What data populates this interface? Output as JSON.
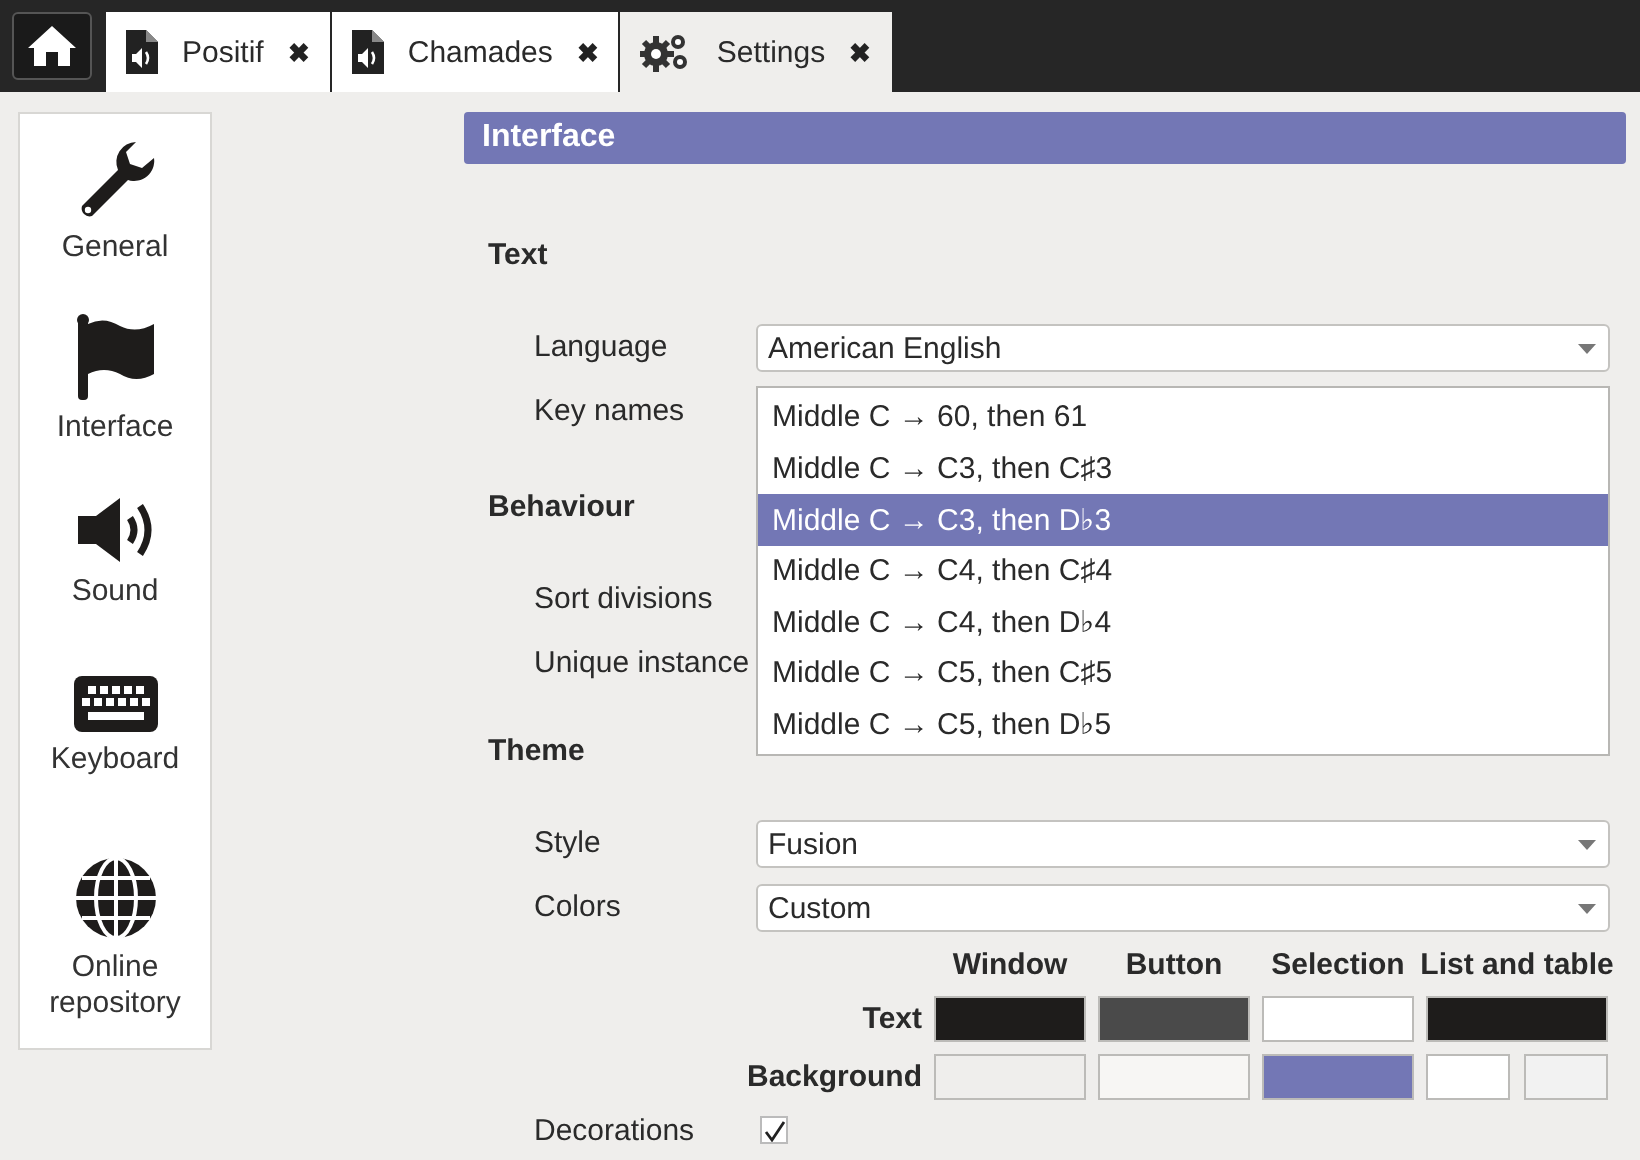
{
  "tabs": [
    {
      "kind": "home",
      "selected": false
    },
    {
      "kind": "document",
      "label": "Positif",
      "close": "✖",
      "selected": false
    },
    {
      "kind": "document",
      "label": "Chamades",
      "close": "✖",
      "selected": false
    },
    {
      "kind": "settings",
      "label": "Settings",
      "close": "✖",
      "selected": true
    }
  ],
  "sidebar": {
    "items": [
      {
        "kind": "wrench",
        "label": "General"
      },
      {
        "kind": "flag",
        "label": "Interface"
      },
      {
        "kind": "speaker",
        "label": "Sound"
      },
      {
        "kind": "keyboard",
        "label": "Keyboard"
      },
      {
        "kind": "globe",
        "label": "Online repository"
      }
    ]
  },
  "page": {
    "title": "Interface",
    "sections": [
      {
        "title": "Text",
        "rows": [
          {
            "kind": "combo",
            "label": "Language",
            "value": "American English"
          },
          {
            "kind": "covered",
            "label": "Key names"
          }
        ]
      },
      {
        "title": "Behaviour",
        "rows": [
          {
            "kind": "covered",
            "label": "Sort divisions"
          },
          {
            "kind": "plain",
            "label": "Unique instance"
          }
        ]
      },
      {
        "title": "Theme",
        "rows": [
          {
            "kind": "combo",
            "label": "Style",
            "value": "Fusion"
          },
          {
            "kind": "combo",
            "label": "Colors",
            "value": "Custom"
          },
          {
            "kind": "colors",
            "columns": [
              "Window",
              "Button",
              "Selection",
              "List and table"
            ],
            "rows": [
              {
                "label": "Text",
                "swatches": [
                  [
                    {
                      "color": "#1e1c1b"
                    }
                  ],
                  [
                    {
                      "color": "#4a4a4a"
                    }
                  ],
                  [
                    {
                      "color": "#ffffff"
                    }
                  ],
                  [
                    {
                      "color": "#1e1c1b"
                    }
                  ]
                ]
              },
              {
                "label": "Background",
                "swatches": [
                  [
                    {
                      "color": "#efeeec"
                    }
                  ],
                  [
                    {
                      "color": "#f7f6f4"
                    }
                  ],
                  [
                    {
                      "color": "#7377b5"
                    }
                  ],
                  [
                    {
                      "color": "#ffffff"
                    },
                    {
                      "color": "#f2f2f2"
                    }
                  ]
                ]
              }
            ]
          },
          {
            "kind": "checkbox",
            "label": "Decorations",
            "checked": true
          }
        ]
      }
    ]
  },
  "popup": {
    "options": [
      {
        "label": "Middle C → 60, then 61",
        "selected": false
      },
      {
        "label": "Middle C → C3, then C♯3",
        "selected": false
      },
      {
        "label": "Middle C → C3, then D♭3",
        "selected": true
      },
      {
        "label": "Middle C → C4, then C♯4",
        "selected": false
      },
      {
        "label": "Middle C → C4, then D♭4",
        "selected": false
      },
      {
        "label": "Middle C → C5, then C♯5",
        "selected": false
      },
      {
        "label": "Middle C → C5, then D♭5",
        "selected": false
      }
    ]
  }
}
